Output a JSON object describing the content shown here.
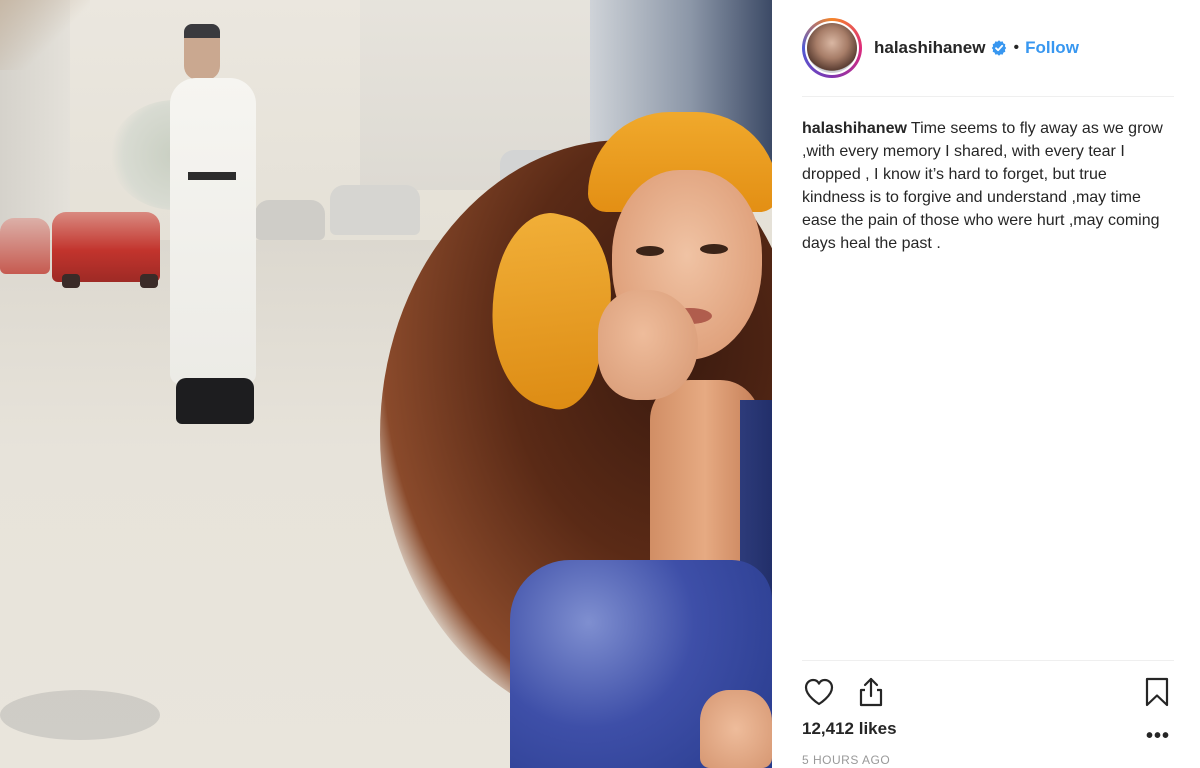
{
  "post": {
    "username": "halashihanew",
    "separator": "•",
    "follow_label": "Follow",
    "verified_icon": "verified-badge-icon"
  },
  "caption": {
    "username": "halashihanew",
    "text": "Time seems to fly away as we grow ,with every memory I shared, with every tear I dropped , I know it’s hard to forget, but true kindness is to forgive and understand ,may time ease the pain of those who were hurt ,may coming days heal the past ."
  },
  "actions": {
    "like_icon": "heart-icon",
    "share_icon": "share-icon",
    "save_icon": "bookmark-icon",
    "more_label": "•••"
  },
  "stats": {
    "likes": "12,412 likes",
    "time": "5 HOURS AGO"
  },
  "colors": {
    "link": "#3897f0",
    "text": "#262626",
    "muted": "#999999",
    "divider": "#efefef"
  }
}
